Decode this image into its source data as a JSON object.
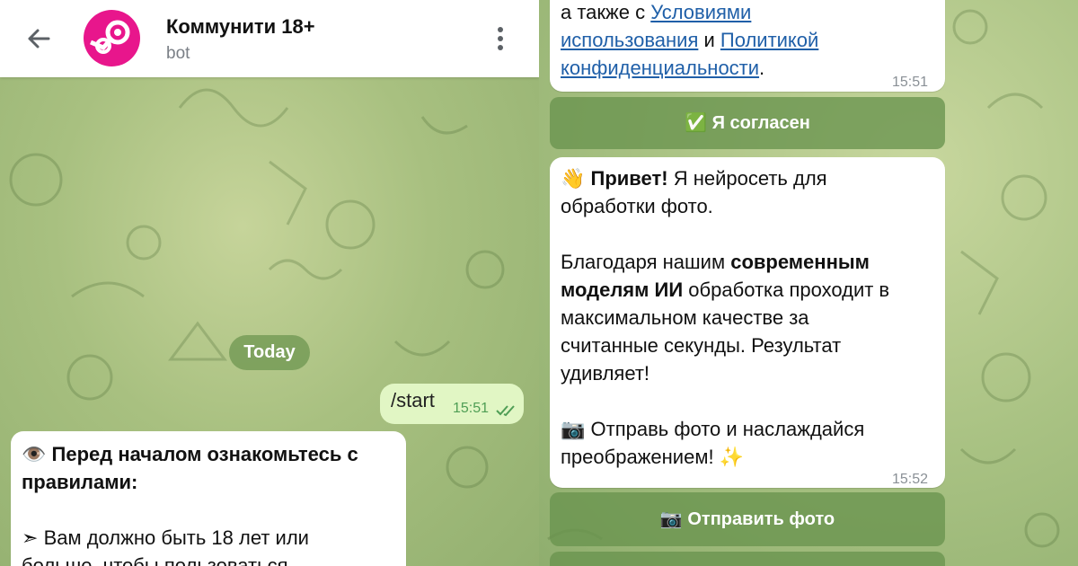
{
  "header": {
    "title": "Коммунити 18+",
    "subtitle": "bot"
  },
  "left": {
    "date_label": "Today",
    "outgoing": {
      "text": "/start",
      "time": "15:51"
    },
    "rules_message": {
      "icon": "👁️",
      "heading_line1": "Перед началом ознакомьтесь с",
      "heading_line2": "правилами:",
      "bullet_icon": "➣",
      "line1": "Вам должно быть 18 лет или",
      "line2_partial": "больше, чтобы пользоваться"
    }
  },
  "right": {
    "terms_message": {
      "line1_prefix": "а также с ",
      "link1_part1": "Условиями",
      "link1_part2": "использования",
      "connector": " и ",
      "link2_part1": "Политикой",
      "link2_part2": "конфиденциальности",
      "suffix": ".",
      "time": "15:51"
    },
    "agree_button": {
      "icon": "✅",
      "label": "Я согласен"
    },
    "greeting_message": {
      "wave_icon": "👋",
      "bold1": "Привет!",
      "text1": " Я нейросеть для",
      "line2": "обработки фото.",
      "p2_prefix": "Благодаря нашим ",
      "p2_bold1": "современным",
      "p2_bold2": "моделям ИИ",
      "p2_rest1": " обработка проходит в",
      "p2_line3": "максимальном качестве за",
      "p2_line4": "считанные секунды. Результат",
      "p2_line5": "удивляет!",
      "camera_icon": "📷",
      "p3_line1": " Отправь фото и наслаждайся",
      "p3_line2": "преображением! ",
      "sparkle_icon": "✨",
      "time": "15:52"
    },
    "send_photo_button": {
      "icon": "📷",
      "label": "Отправить фото"
    }
  },
  "colors": {
    "avatar_bg": "#e8168c",
    "link": "#1f5fa8",
    "outgoing_bubble": "#e1f6c4",
    "read_checks": "#4f9e55"
  }
}
